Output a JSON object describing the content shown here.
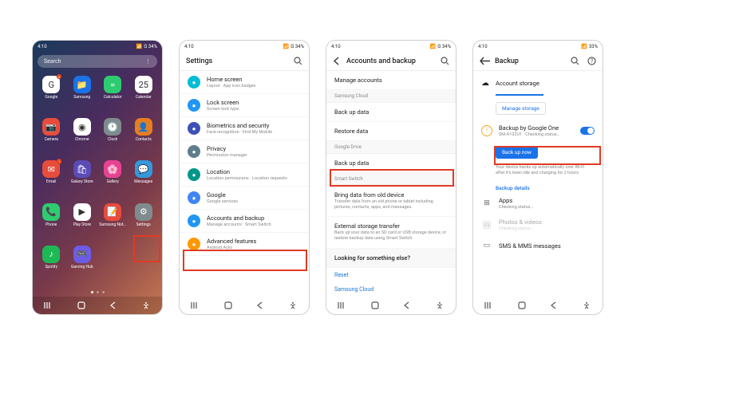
{
  "common": {
    "time": "4:10",
    "status_indicators": "G 34%",
    "battery_alt": "33%"
  },
  "phone1": {
    "search_placeholder": "Search",
    "apps": [
      {
        "label": "Google",
        "color": "#fff",
        "glyph": "G",
        "badge": "5"
      },
      {
        "label": "Samsung",
        "color": "#1a73e8",
        "glyph": "📁"
      },
      {
        "label": "Calculator",
        "color": "#2ecc71",
        "glyph": "="
      },
      {
        "label": "Calendar",
        "color": "#fff",
        "glyph": "25"
      },
      {
        "label": "Camera",
        "color": "#e74c3c",
        "glyph": "📷"
      },
      {
        "label": "Chrome",
        "color": "#fff",
        "glyph": "◉"
      },
      {
        "label": "Clock",
        "color": "#7f8c8d",
        "glyph": "🕐"
      },
      {
        "label": "Contacts",
        "color": "#e67e22",
        "glyph": "👤"
      },
      {
        "label": "Email",
        "color": "#e74c3c",
        "glyph": "✉",
        "badge": "1"
      },
      {
        "label": "Galaxy Store",
        "color": "#5b4bb5",
        "glyph": "🛍"
      },
      {
        "label": "Gallery",
        "color": "#e84393",
        "glyph": "🌸"
      },
      {
        "label": "Messages",
        "color": "#3498db",
        "glyph": "💬"
      },
      {
        "label": "Phone",
        "color": "#2ecc71",
        "glyph": "📞"
      },
      {
        "label": "Play Store",
        "color": "#fff",
        "glyph": "▶"
      },
      {
        "label": "Samsung Notes",
        "color": "#e74c3c",
        "glyph": "📝"
      },
      {
        "label": "Settings",
        "color": "#7f8c8d",
        "glyph": "⚙"
      },
      {
        "label": "Spotify",
        "color": "#1db954",
        "glyph": "♪"
      },
      {
        "label": "Gaming Hub",
        "color": "#6c5ce7",
        "glyph": "🎮"
      }
    ]
  },
  "phone2": {
    "title": "Settings",
    "rows": [
      {
        "title": "Home screen",
        "sub": "Layout · App icon badges",
        "color": "#00bcd4"
      },
      {
        "title": "Lock screen",
        "sub": "Screen lock type",
        "color": "#2196f3"
      },
      {
        "title": "Biometrics and security",
        "sub": "Face recognition · Find My Mobile",
        "color": "#3f51b5"
      },
      {
        "title": "Privacy",
        "sub": "Permission manager",
        "color": "#607d8b"
      },
      {
        "title": "Location",
        "sub": "Location permissions · Location requests",
        "color": "#009688"
      },
      {
        "title": "Google",
        "sub": "Google services",
        "color": "#4285f4"
      },
      {
        "title": "Accounts and backup",
        "sub": "Manage accounts · Smart Switch",
        "color": "#2196f3"
      },
      {
        "title": "Advanced features",
        "sub": "Android Auto",
        "color": "#ff9800"
      }
    ]
  },
  "phone3": {
    "title": "Accounts and backup",
    "manage_accounts": "Manage accounts",
    "sections": [
      {
        "label": "Samsung Cloud",
        "rows": [
          {
            "title": "Back up data"
          },
          {
            "title": "Restore data"
          }
        ]
      },
      {
        "label": "Google Drive",
        "rows": [
          {
            "title": "Back up data"
          }
        ]
      },
      {
        "label": "Smart Switch",
        "rows": [
          {
            "title": "Bring data from old device",
            "sub": "Transfer data from an old phone or tablet including pictures, contacts, apps, and messages."
          },
          {
            "title": "External storage transfer",
            "sub": "Back up your data to an SD card or USB storage device, or restore backup data using Smart Switch."
          }
        ]
      }
    ],
    "looking": "Looking for something else?",
    "links": [
      "Reset",
      "Samsung Cloud"
    ]
  },
  "phone4": {
    "title": "Backup",
    "account_storage": "Account storage",
    "manage_storage": "Manage storage",
    "backup_one": {
      "title": "Backup by Google One",
      "sub": "SM-A102U1 · Checking status…"
    },
    "backup_now": "Back up now",
    "info": "Your device backs up automatically over Wi-Fi after it's been idle and charging for 2 hours",
    "details_label": "Backup details",
    "details": [
      {
        "title": "Apps",
        "sub": "Checking status…",
        "glyph": "⊞"
      },
      {
        "title": "Photos & videos",
        "sub": "Checking status…",
        "glyph": "🖼",
        "faded": true
      },
      {
        "title": "SMS & MMS messages",
        "sub": "",
        "glyph": "▭"
      }
    ]
  }
}
